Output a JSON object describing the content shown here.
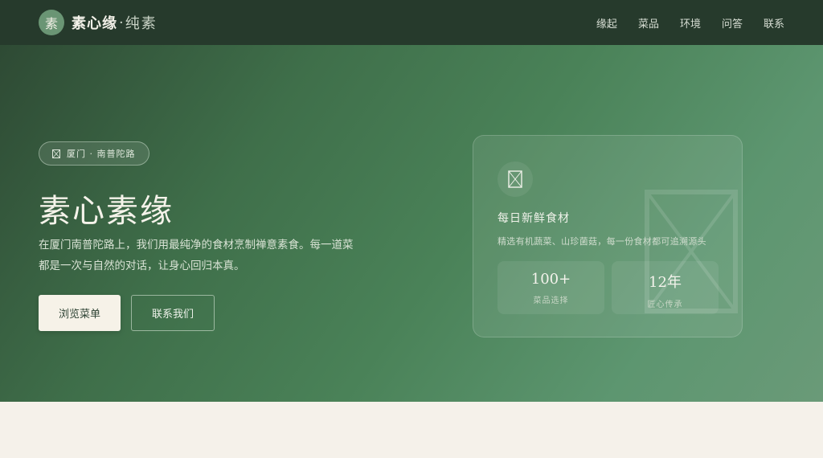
{
  "colors": {
    "nav_bg": "#263a2c",
    "hero_start": "#2e4a34",
    "hero_end": "#6a9a78",
    "accent": "#6a9574",
    "cream": "#f6f2e8"
  },
  "nav": {
    "logo_char": "素",
    "brand_main": "素心缘",
    "brand_sep": "·",
    "brand_sub": "纯素",
    "links": [
      "缘起",
      "菜品",
      "环境",
      "问答",
      "联系"
    ]
  },
  "hero": {
    "location_icon": "document-icon",
    "location": "厦门 · 南普陀路",
    "title": "素心素缘",
    "description": "在厦门南普陀路上，我们用最纯净的食材烹制禅意素食。每一道菜都是一次与自然的对话，让身心回归本真。",
    "primary_button": "浏览菜单",
    "secondary_button": "联系我们"
  },
  "card": {
    "icon": "document-icon",
    "title": "每日新鲜食材",
    "description": "精选有机蔬菜、山珍菌菇，每一份食材都可追溯源头",
    "stats": [
      {
        "value": "100+",
        "label": "菜品选择"
      },
      {
        "value": "12年",
        "label": "匠心传承"
      }
    ]
  }
}
